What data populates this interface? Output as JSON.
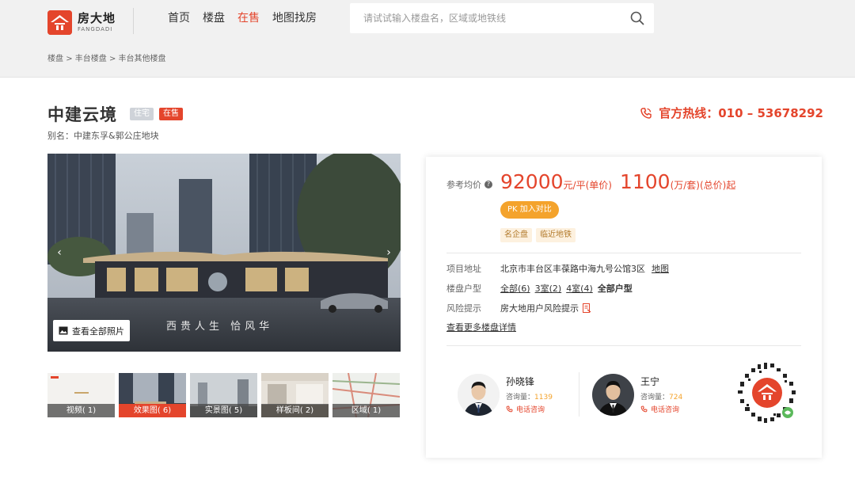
{
  "header": {
    "logo_cn": "房大地",
    "logo_en": "FANGDADI",
    "nav": [
      {
        "label": "首页",
        "active": false
      },
      {
        "label": "楼盘",
        "active": false
      },
      {
        "label": "在售",
        "active": true
      },
      {
        "label": "地图找房",
        "active": false
      }
    ],
    "search_placeholder": "请试试输入楼盘名，区域或地铁线"
  },
  "breadcrumb": [
    "楼盘",
    "丰台楼盘",
    "丰台其他楼盘"
  ],
  "breadcrumb_sep": ">",
  "project": {
    "title": "中建云境",
    "tag_type": "住宅",
    "tag_sale": "在售",
    "alias": "别名：中建东孚&郭公庄地块",
    "hotline": "官方热线：010 – 53678292"
  },
  "gallery": {
    "slogan": "西贵人生  恰风华",
    "view_all": "查看全部照片",
    "thumbs": [
      {
        "label": "视频( 1)",
        "active": false
      },
      {
        "label": "效果图( 6)",
        "active": true
      },
      {
        "label": "实景图( 5)",
        "active": false
      },
      {
        "label": "样板间( 2)",
        "active": false
      },
      {
        "label": "区域( 1)",
        "active": false
      }
    ]
  },
  "price": {
    "label": "参考均价",
    "help_icon": "?",
    "unit_price": "92000",
    "unit_price_unit": "元/平(单价)",
    "total_price": "1100",
    "total_price_unit": "(万/套)(总价)起",
    "pk_button": "PK 加入对比",
    "features": [
      "名企盘",
      "临近地铁"
    ]
  },
  "details": {
    "address_label": "项目地址",
    "address": "北京市丰台区丰葆路中海九号公馆3区",
    "map_link": "地图",
    "layout_label": "楼盘户型",
    "layouts": [
      "全部(6)",
      "3室(2)",
      "4室(4)"
    ],
    "all_layouts": "全部户型",
    "risk_label": "风险提示",
    "risk_text": "房大地用户风险提示",
    "more_link": "查看更多楼盘详情"
  },
  "agents": [
    {
      "name": "孙晓锋",
      "count_label": "咨询量：",
      "count": "1139",
      "call": "电话咨询"
    },
    {
      "name": "王宁",
      "count_label": "咨询量：",
      "count": "724",
      "call": "电话咨询"
    }
  ],
  "colors": {
    "brand": "#e4452c",
    "accent": "#f4a32c"
  }
}
